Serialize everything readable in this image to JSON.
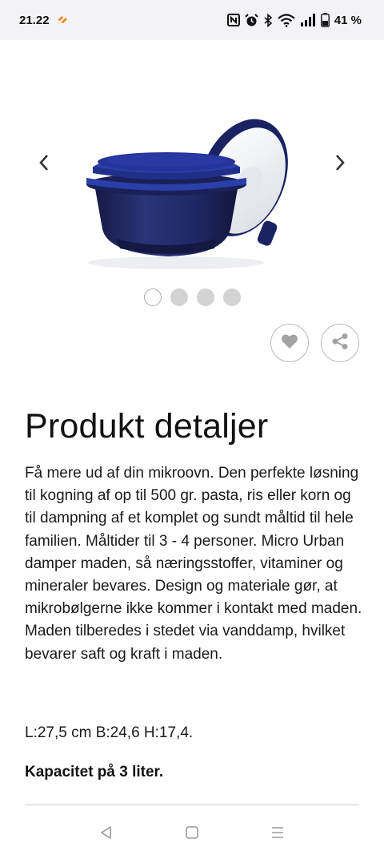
{
  "status_bar": {
    "time": "21.22",
    "battery": "41 %",
    "icons": [
      "notification-app-icon",
      "nfc-icon",
      "alarm-icon",
      "bluetooth-icon",
      "wifi-icon",
      "signal-icon",
      "battery-icon"
    ]
  },
  "carousel": {
    "image_alt": "Micro Urban damper",
    "slide_count": 4,
    "active_slide": 1,
    "prev_icon": "chevron-left-icon",
    "next_icon": "chevron-right-icon"
  },
  "actions": {
    "favorite_icon": "heart-icon",
    "share_icon": "share-icon"
  },
  "details": {
    "title": "Produkt detaljer",
    "description": "Få mere ud af din mikroovn. Den perfekte løsning til kogning af op til 500 gr. pasta, ris eller korn og til dampning af et komplet og sundt måltid til hele familien. Måltider til 3 - 4 personer. Micro Urban damper maden, så næringsstoffer, vitaminer og mineraler bevares. Design og materiale gør, at mikrobølgerne ikke kommer i kontakt med maden. Maden tilberedes i stedet via vanddamp, hvilket bevarer saft og kraft i maden.",
    "dimensions": "L:27,5 cm B:24,6 H:17,4.",
    "capacity": "Kapacitet på 3 liter."
  },
  "navigation": {
    "back_icon": "back-triangle-icon",
    "home_icon": "home-square-icon",
    "menu_icon": "menu-lines-icon"
  },
  "colors": {
    "product_navy": "#1f2a6b",
    "product_blue": "#2a3fa8",
    "lid_white": "#eef0f2",
    "status_bg": "#f3f3f6"
  }
}
